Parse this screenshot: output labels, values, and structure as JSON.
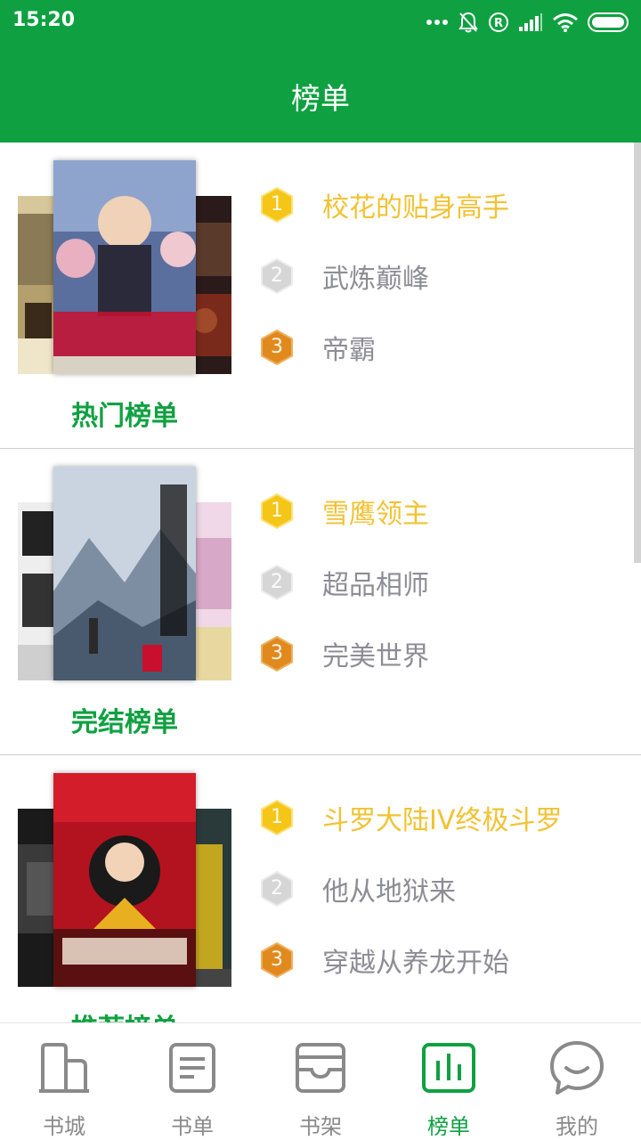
{
  "status_bar": {
    "time": "15:20"
  },
  "header": {
    "title": "榜单"
  },
  "colors": {
    "brand": "#0fa141",
    "gold": "#f1c232",
    "silver": "#c8c8c8",
    "bronze": "#e08a1e",
    "text_gray": "#8d8d95"
  },
  "sections": [
    {
      "title": "热门榜单",
      "items": [
        {
          "rank": "1",
          "name": "校花的贴身高手"
        },
        {
          "rank": "2",
          "name": "武炼巅峰"
        },
        {
          "rank": "3",
          "name": "帝霸"
        }
      ]
    },
    {
      "title": "完结榜单",
      "items": [
        {
          "rank": "1",
          "name": "雪鹰领主"
        },
        {
          "rank": "2",
          "name": "超品相师"
        },
        {
          "rank": "3",
          "name": "完美世界"
        }
      ]
    },
    {
      "title": "推荐榜单",
      "items": [
        {
          "rank": "1",
          "name": "斗罗大陆IV终极斗罗"
        },
        {
          "rank": "2",
          "name": "他从地狱来"
        },
        {
          "rank": "3",
          "name": "穿越从养龙开始"
        }
      ]
    }
  ],
  "bottom_nav": [
    {
      "label": "书城",
      "icon": "building-icon"
    },
    {
      "label": "书单",
      "icon": "document-icon"
    },
    {
      "label": "书架",
      "icon": "shelf-tray-icon"
    },
    {
      "label": "榜单",
      "icon": "chart-icon",
      "active": true
    },
    {
      "label": "我的",
      "icon": "chat-smile-icon"
    }
  ]
}
